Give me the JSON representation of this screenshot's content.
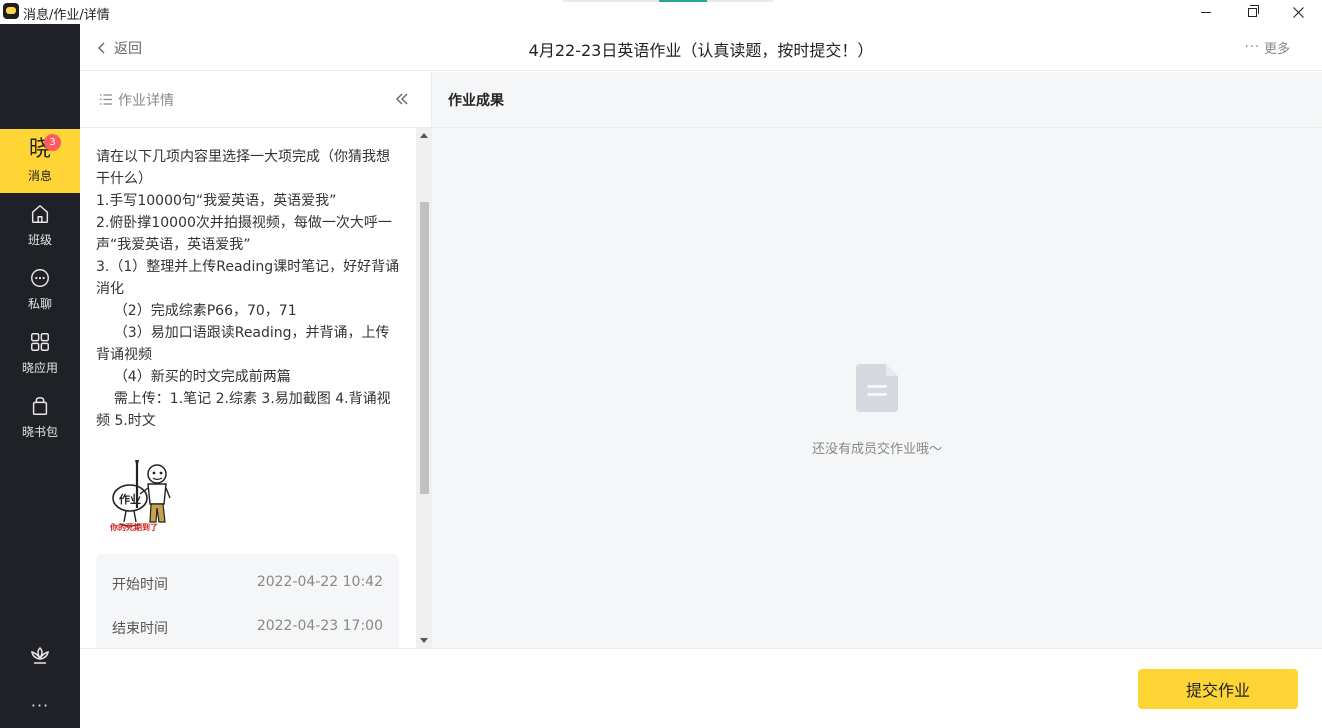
{
  "window": {
    "title": "消息/作业/详情",
    "controls": {
      "minimize": "minimize-icon",
      "maximize": "restore-icon",
      "close": "close-icon"
    }
  },
  "sidebar": {
    "logo_char": "晓",
    "badge_count": "3",
    "items": [
      {
        "label": "消息",
        "icon": "message-icon",
        "active": true
      },
      {
        "label": "班级",
        "icon": "home-icon",
        "active": false
      },
      {
        "label": "私聊",
        "icon": "chat-bubble-icon",
        "active": false
      },
      {
        "label": "晓应用",
        "icon": "app-grid-icon",
        "active": false
      },
      {
        "label": "晓书包",
        "icon": "schoolbag-icon",
        "active": false
      }
    ],
    "bottom_icons": [
      "lotus-icon",
      "more-dots-icon"
    ],
    "more_label": "···",
    "accent_color": "#ffd535",
    "background_color": "#1f2126"
  },
  "header": {
    "back_label": "返回",
    "title": "4月22-23日英语作业（认真读题，按时提交！）",
    "more_label": "更多",
    "more_dots": "···"
  },
  "detail_panel": {
    "title": "作业详情",
    "collapse_icon": "double-chevron-left-icon",
    "description": "请在以下几项内容里选择一大项完成（你猜我想干什么）\n1.手写10000句“我爱英语，英语爱我”\n2.俯卧撑10000次并拍摄视频，每做一次大呼一声“我爱英语，英语爱我”\n3.（1）整理并上传Reading课时笔记，好好背诵消化\n    （2）完成综素P66，70，71\n    （3）易加口语跟读Reading，并背诵，上传背诵视频\n    （4）新买的时文完成前两篇\n    需上传：1.笔记 2.综素 3.易加截图 4.背诵视频 5.时文",
    "sticker": {
      "text": "作业",
      "caption": "你的死期到了"
    },
    "times": {
      "start_label": "开始时间",
      "start_value": "2022-04-22 10:42",
      "end_label": "结束时间",
      "end_value": "2022-04-23 17:00"
    }
  },
  "results_panel": {
    "title": "作业成果",
    "empty_icon": "document-icon",
    "empty_text": "还没有成员交作业哦～"
  },
  "footer": {
    "submit_label": "提交作业",
    "submit_color": "#ffd535"
  }
}
